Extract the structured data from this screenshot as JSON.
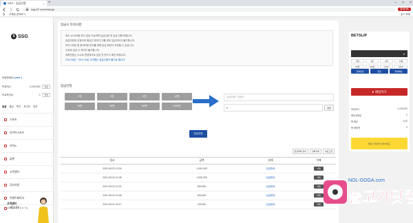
{
  "browser": {
    "tab_title": "SSG - 입금신청",
    "tab_close": "×",
    "new_tab": "+",
    "url": "ssg-87.com/charge",
    "update_label": "업데이트",
    "bookmarks": [
      "앱",
      "카톡방 문의하기"
    ],
    "bookmarks_right": "읽기 목록",
    "win_min": "–",
    "win_max": "□",
    "win_close": "×"
  },
  "sidebar": {
    "logo": "SSG",
    "user_prefix": "안녕하세요",
    "user_level": "Level 1",
    "rows": [
      {
        "label": "보유머니",
        "value": "2,240,000",
        "button": "입금"
      },
      {
        "label": "보유포인트",
        "value": "0",
        "button": "전환"
      }
    ],
    "tabs": [
      "입금",
      "출금",
      "쪽지",
      "포인트",
      "정보"
    ],
    "menu": [
      "스포츠",
      "라이브스포츠",
      "카지노",
      "슬롯",
      "고객센터",
      "공지사항",
      "이벤트페이지",
      "배팅내역"
    ],
    "cs_title": "고객센터",
    "cs_desc": "실시간 24시간 상담 가능"
  },
  "main": {
    "notice_title": "입금시 유의사항",
    "notices": [
      "최소 10,000원 부터 입금 가능하며 입금신청 후 입금 진행 바랍니다.",
      "입금자명과 신청자의 예금주 명의가 다를 경우 입금처리가 불가합니다.",
      "보이스피싱 및 명의도용 방지를 위해 입금 확인이 지연될 수 있습니다.",
      "수표로 입금 시 처리가 불가합니다.",
      "계좌번호는 수시로 변경되므로 입금 전 반드시 확인 바랍니다.",
      "23시 50분 ~ 00시 10분 사이에는 입금신청이 불가능 합니다."
    ],
    "deposit_title": "입금신청",
    "amounts": [
      "1만",
      "3만",
      "5만",
      "10만",
      "30만",
      "50만",
      "100만",
      "1000만"
    ],
    "name_placeholder": "입금자명 : 이한석",
    "amount_value": "0",
    "reset_label": "정정",
    "submit_label": "입금신청",
    "history_buttons": [
      "입금계좌 문의",
      "전체삭제",
      "새로고침"
    ],
    "columns": [
      "일시",
      "금액",
      "상태",
      "삭제"
    ],
    "rows": [
      {
        "date": "2021.06.22 13:24",
        "amount": "1,000,000",
        "status": "입금완료",
        "del": "삭제"
      },
      {
        "date": "2021.06.22 12:48",
        "amount": "1,000,000",
        "status": "입금완료",
        "del": "삭제"
      },
      {
        "date": "2021.06.22 12:21",
        "amount": "600,000",
        "status": "입금완료",
        "del": "삭제"
      },
      {
        "date": "2021.06.22 13:06",
        "amount": "600,000",
        "status": "입금완료",
        "del": "삭제"
      },
      {
        "date": "2021.06.21 15:17",
        "amount": "100,000",
        "status": "입금완료",
        "del": "삭제"
      }
    ]
  },
  "betslip": {
    "title": "BETSLIP",
    "amount": "0",
    "chips": [
      "5천",
      "1만",
      "5만",
      "10만",
      "50만",
      "100만",
      "HALF",
      "MAX"
    ],
    "chips2": [
      "금액정정",
      "정정",
      "최대배팅"
    ],
    "bet_button": "배팅하기",
    "rows": [
      {
        "label": "보유머니",
        "value": "2,240,000"
      },
      {
        "label": "배당금예상",
        "value": "0"
      },
      {
        "label": "총 배당",
        "value": "0.00"
      },
      {
        "label": "총 배팅액",
        "value": "0"
      }
    ],
    "warning": "배팅할 게임을 선택하세요."
  },
  "watermark": {
    "domain": "NOL-GOGA.com",
    "text": "놀고가닷컴"
  },
  "colors": {
    "accent": "#1e4fa3",
    "bet": "#c62828",
    "warn": "#fdd835"
  }
}
